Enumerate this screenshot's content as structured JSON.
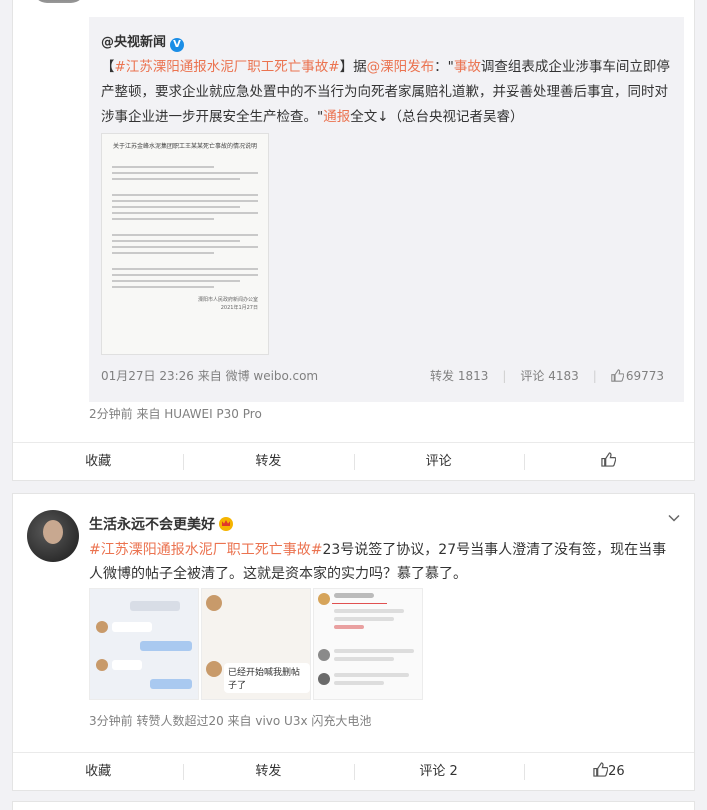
{
  "card1": {
    "repost": {
      "author": "@央视新闻",
      "verified_mark": "V",
      "text_parts": {
        "p1": "【",
        "tag": "#江苏溧阳通报水泥厂职工死亡事故#",
        "p2": "】据",
        "mention": "@溧阳发布",
        "p3": "：\"",
        "kw1": "事故",
        "p4": "调查组表成企业涉事车间立即停产整顿，要求企业就应急处置中的不当行为向死者家属赔礼道歉，并妥善处理善后事宜，同时对涉事企业进一步开展安全生产检查。\"",
        "kw2": "通报",
        "p5": "全文↓（总台央视记者吴睿）"
      },
      "doc_title": "关于江苏金峰水泥集团职工王某某死亡事故的情况说明",
      "doc_sign": "溧阳市人民政府新闻办公室\n2021年1月27日",
      "meta": "01月27日 23:26 来自 微博 weibo.com",
      "stats": {
        "repost": "转发 1813",
        "comment": "评论 4183",
        "like": "69773"
      }
    },
    "meta": "2分钟前  来自 HUAWEI P30 Pro",
    "actions": {
      "fav": "收藏",
      "repost": "转发",
      "comment": "评论",
      "like": ""
    }
  },
  "card2": {
    "username": "生活永远不会更美好",
    "text_parts": {
      "tag": "#江苏溧阳通报水泥厂职工死亡事故#",
      "body": "23号说签了协议，27号当事人澄清了没有签，现在当事人微博的帖子全被清了。这就是资本家的实力吗？慕了慕了。"
    },
    "shot2_text": "已经开始喊我删帖子了",
    "meta": "3分钟前 转赞人数超过20  来自 vivo U3x 闪充大电池",
    "actions": {
      "fav": "收藏",
      "repost": "转发",
      "comment": "评论 2",
      "like": "26"
    }
  },
  "colors": {
    "link": "#eb7350",
    "mention_blue": "#5d7fb0",
    "verified": "#1b8ee6",
    "page_bg": "#f2f2f5"
  },
  "icons": [
    "verified-icon",
    "like-icon",
    "crown-badge-icon",
    "chevron-down-icon"
  ]
}
